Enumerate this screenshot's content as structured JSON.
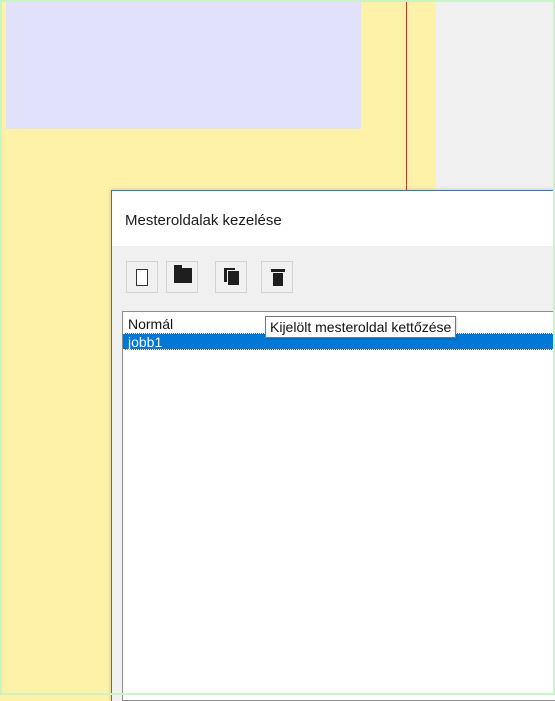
{
  "dialog": {
    "title": "Mesteroldalak kezelése"
  },
  "toolbar": {
    "buttons": [
      {
        "icon": "new-page-icon"
      },
      {
        "icon": "open-folder-icon"
      },
      {
        "icon": "copy-pages-icon"
      },
      {
        "icon": "trash-icon"
      }
    ]
  },
  "master_pages": {
    "items": [
      {
        "label": "Normál",
        "selected": false
      },
      {
        "label": "jobb1",
        "selected": true
      }
    ]
  },
  "tooltip": {
    "text": "Kijelölt mesteroldal kettőzése"
  },
  "colors": {
    "page_background": "#fdf2a7",
    "frame_lavender": "#e2e1fb",
    "guide_line": "#c0392b",
    "selection": "#0078d7",
    "outer_border": "#c7f5c3"
  }
}
